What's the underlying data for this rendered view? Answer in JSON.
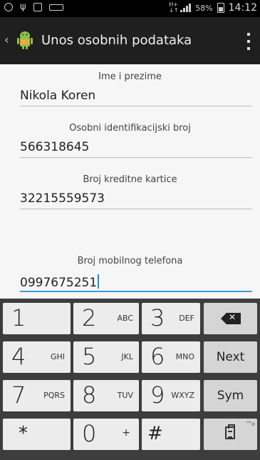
{
  "status_bar": {
    "battery_percent": "58%",
    "time": "14:12",
    "icons": [
      "notification-icon",
      "usb-icon",
      "image-icon",
      "keyboard-icon",
      "hplus-network-icon",
      "signal-icon",
      "battery-icon"
    ]
  },
  "action_bar": {
    "title": "Unos osobnih podataka",
    "icons": [
      "back-chevron-icon",
      "android-app-icon",
      "overflow-menu-icon"
    ]
  },
  "form": {
    "fields": [
      {
        "label": "Ime i prezime",
        "value": "Nikola Koren"
      },
      {
        "label": "Osobni identifikacijski broj",
        "value": "566318645"
      },
      {
        "label": "Broj kreditne kartice",
        "value": "32215559573"
      },
      {
        "label": "Broj mobilnog telefona",
        "value": "0997675251"
      }
    ],
    "focused_field": 3
  },
  "keyboard": {
    "rows": [
      [
        {
          "num": "1",
          "letters": ""
        },
        {
          "num": "2",
          "letters": "ABC"
        },
        {
          "num": "3",
          "letters": "DEF"
        }
      ],
      [
        {
          "num": "4",
          "letters": "GHI"
        },
        {
          "num": "5",
          "letters": "JKL"
        },
        {
          "num": "6",
          "letters": "MNO"
        }
      ],
      [
        {
          "num": "7",
          "letters": "PQRS"
        },
        {
          "num": "8",
          "letters": "TUV"
        },
        {
          "num": "9",
          "letters": "WXYZ"
        }
      ],
      [
        {
          "num": "*",
          "letters": ""
        },
        {
          "num": "0",
          "letters": "+"
        },
        {
          "num": "#",
          "letters": ""
        }
      ]
    ],
    "action_keys": {
      "next": "Next",
      "sym": "Sym",
      "clipboard_dots": "\"\"o"
    }
  },
  "colors": {
    "accent": "#3a9fd8",
    "action_bar": "#1f1f1f",
    "content_bg": "#f6f6f6",
    "keyboard_bg": "#3d3d3d",
    "key_bg": "#ececec"
  }
}
